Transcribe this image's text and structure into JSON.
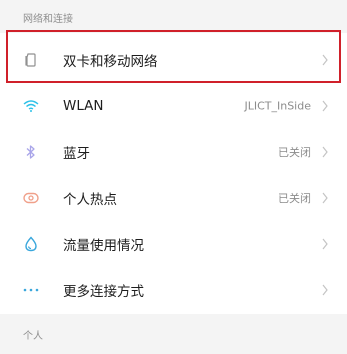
{
  "sections": {
    "network": {
      "title": "网络和连接"
    },
    "personal": {
      "title": "个人"
    }
  },
  "rows": [
    {
      "label": "双卡和移动网络",
      "value": "",
      "icon": "sim-card-icon",
      "icon_color": "#909090"
    },
    {
      "label": "WLAN",
      "value": "JLICT_InSide",
      "icon": "wifi-icon",
      "icon_color": "#2ec1e8"
    },
    {
      "label": "蓝牙",
      "value": "已关闭",
      "icon": "bluetooth-icon",
      "icon_color": "#a9a5e9"
    },
    {
      "label": "个人热点",
      "value": "已关闭",
      "icon": "hotspot-icon",
      "icon_color": "#f0a08a"
    },
    {
      "label": "流量使用情况",
      "value": "",
      "icon": "data-usage-icon",
      "icon_color": "#3aa7dc"
    },
    {
      "label": "更多连接方式",
      "value": "",
      "icon": "more-icon",
      "icon_color": "#3aa7dc"
    }
  ],
  "highlight_color": "#d0202a"
}
